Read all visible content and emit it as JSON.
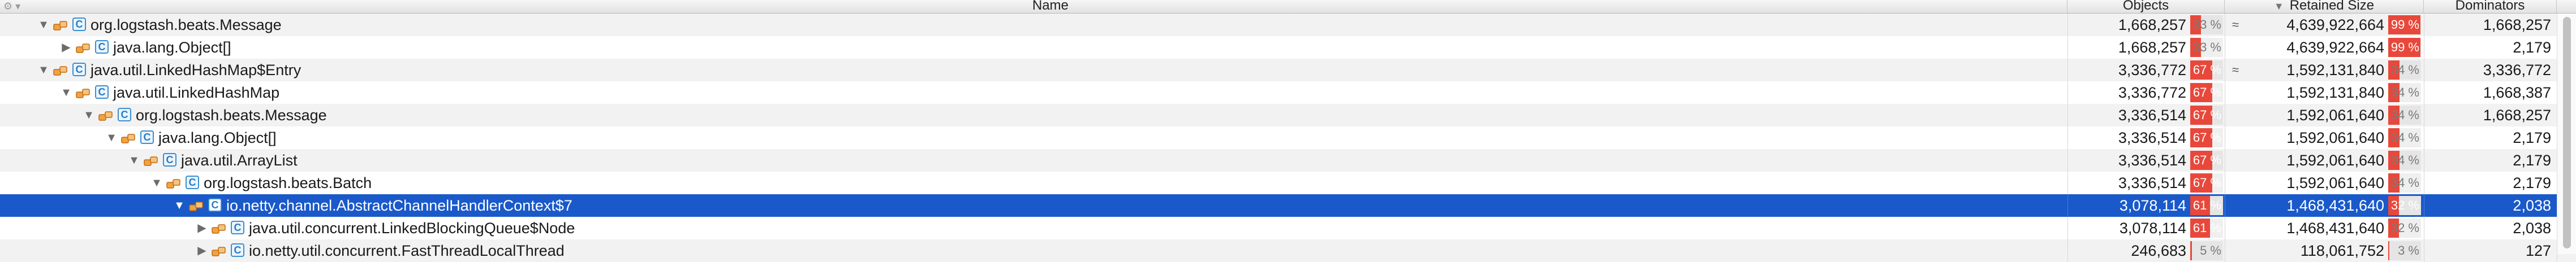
{
  "columns": {
    "name": "Name",
    "objects": "Objects",
    "retained": "Retained Size",
    "dominators": "Dominators",
    "sort_indicator": "▼"
  },
  "rows": [
    {
      "depth": 0,
      "twisty": "expanded",
      "ref_icon": true,
      "name": "org.logstash.beats.Message",
      "objects": "1,668,257",
      "objects_pct": 33,
      "objects_pct_label": "33 %",
      "approx": "≈",
      "retained": "4,639,922,664",
      "retained_pct": 99,
      "retained_pct_label": "99 %",
      "dominators": "1,668,257"
    },
    {
      "depth": 1,
      "twisty": "collapsed",
      "ref_icon": true,
      "name": "java.lang.Object[]",
      "objects": "1,668,257",
      "objects_pct": 33,
      "objects_pct_label": "33 %",
      "approx": "",
      "retained": "4,639,922,664",
      "retained_pct": 99,
      "retained_pct_label": "99 %",
      "dominators": "2,179"
    },
    {
      "depth": 0,
      "twisty": "expanded",
      "ref_icon": true,
      "name": "java.util.LinkedHashMap$Entry",
      "objects": "3,336,772",
      "objects_pct": 67,
      "objects_pct_label": "67 %",
      "approx": "≈",
      "retained": "1,592,131,840",
      "retained_pct": 34,
      "retained_pct_label": "34 %",
      "dominators": "3,336,772"
    },
    {
      "depth": 1,
      "twisty": "expanded",
      "ref_icon": true,
      "name": "java.util.LinkedHashMap",
      "objects": "3,336,772",
      "objects_pct": 67,
      "objects_pct_label": "67 %",
      "approx": "",
      "retained": "1,592,131,840",
      "retained_pct": 34,
      "retained_pct_label": "34 %",
      "dominators": "1,668,387"
    },
    {
      "depth": 2,
      "twisty": "expanded",
      "ref_icon": true,
      "name": "org.logstash.beats.Message",
      "objects": "3,336,514",
      "objects_pct": 67,
      "objects_pct_label": "67 %",
      "approx": "",
      "retained": "1,592,061,640",
      "retained_pct": 34,
      "retained_pct_label": "34 %",
      "dominators": "1,668,257"
    },
    {
      "depth": 3,
      "twisty": "expanded",
      "ref_icon": true,
      "name": "java.lang.Object[]",
      "objects": "3,336,514",
      "objects_pct": 67,
      "objects_pct_label": "67 %",
      "approx": "",
      "retained": "1,592,061,640",
      "retained_pct": 34,
      "retained_pct_label": "34 %",
      "dominators": "2,179"
    },
    {
      "depth": 4,
      "twisty": "expanded",
      "ref_icon": true,
      "name": "java.util.ArrayList",
      "objects": "3,336,514",
      "objects_pct": 67,
      "objects_pct_label": "67 %",
      "approx": "",
      "retained": "1,592,061,640",
      "retained_pct": 34,
      "retained_pct_label": "34 %",
      "dominators": "2,179"
    },
    {
      "depth": 5,
      "twisty": "expanded",
      "ref_icon": true,
      "name": "org.logstash.beats.Batch",
      "objects": "3,336,514",
      "objects_pct": 67,
      "objects_pct_label": "67 %",
      "approx": "",
      "retained": "1,592,061,640",
      "retained_pct": 34,
      "retained_pct_label": "34 %",
      "dominators": "2,179"
    },
    {
      "depth": 6,
      "twisty": "expanded",
      "ref_icon": true,
      "name": "io.netty.channel.AbstractChannelHandlerContext$7",
      "objects": "3,078,114",
      "objects_pct": 61,
      "objects_pct_label": "61 %",
      "approx": "",
      "retained": "1,468,431,640",
      "retained_pct": 32,
      "retained_pct_label": "32 %",
      "dominators": "2,038",
      "selected": true
    },
    {
      "depth": 7,
      "twisty": "collapsed",
      "ref_icon": true,
      "name": "java.util.concurrent.LinkedBlockingQueue$Node",
      "objects": "3,078,114",
      "objects_pct": 61,
      "objects_pct_label": "61 %",
      "approx": "",
      "retained": "1,468,431,640",
      "retained_pct": 32,
      "retained_pct_label": "32 %",
      "dominators": "2,038"
    },
    {
      "depth": 7,
      "twisty": "collapsed",
      "ref_icon": true,
      "name": "io.netty.util.concurrent.FastThreadLocalThread",
      "objects": "246,683",
      "objects_pct": 5,
      "objects_pct_label": "5 %",
      "approx": "",
      "retained": "118,061,752",
      "retained_pct": 3,
      "retained_pct_label": "3 %",
      "dominators": "127"
    }
  ],
  "colors": {
    "selection": "#1a59c9",
    "percent_bar": "#e8483b",
    "class_icon": "#3a8fd0",
    "reference_icon": "#e07b1c"
  },
  "icons": {
    "settings": "gear-icon",
    "expanded": "triangle-down-icon",
    "collapsed": "triangle-right-icon",
    "reference": "field-reference-icon",
    "class": "class-icon"
  }
}
